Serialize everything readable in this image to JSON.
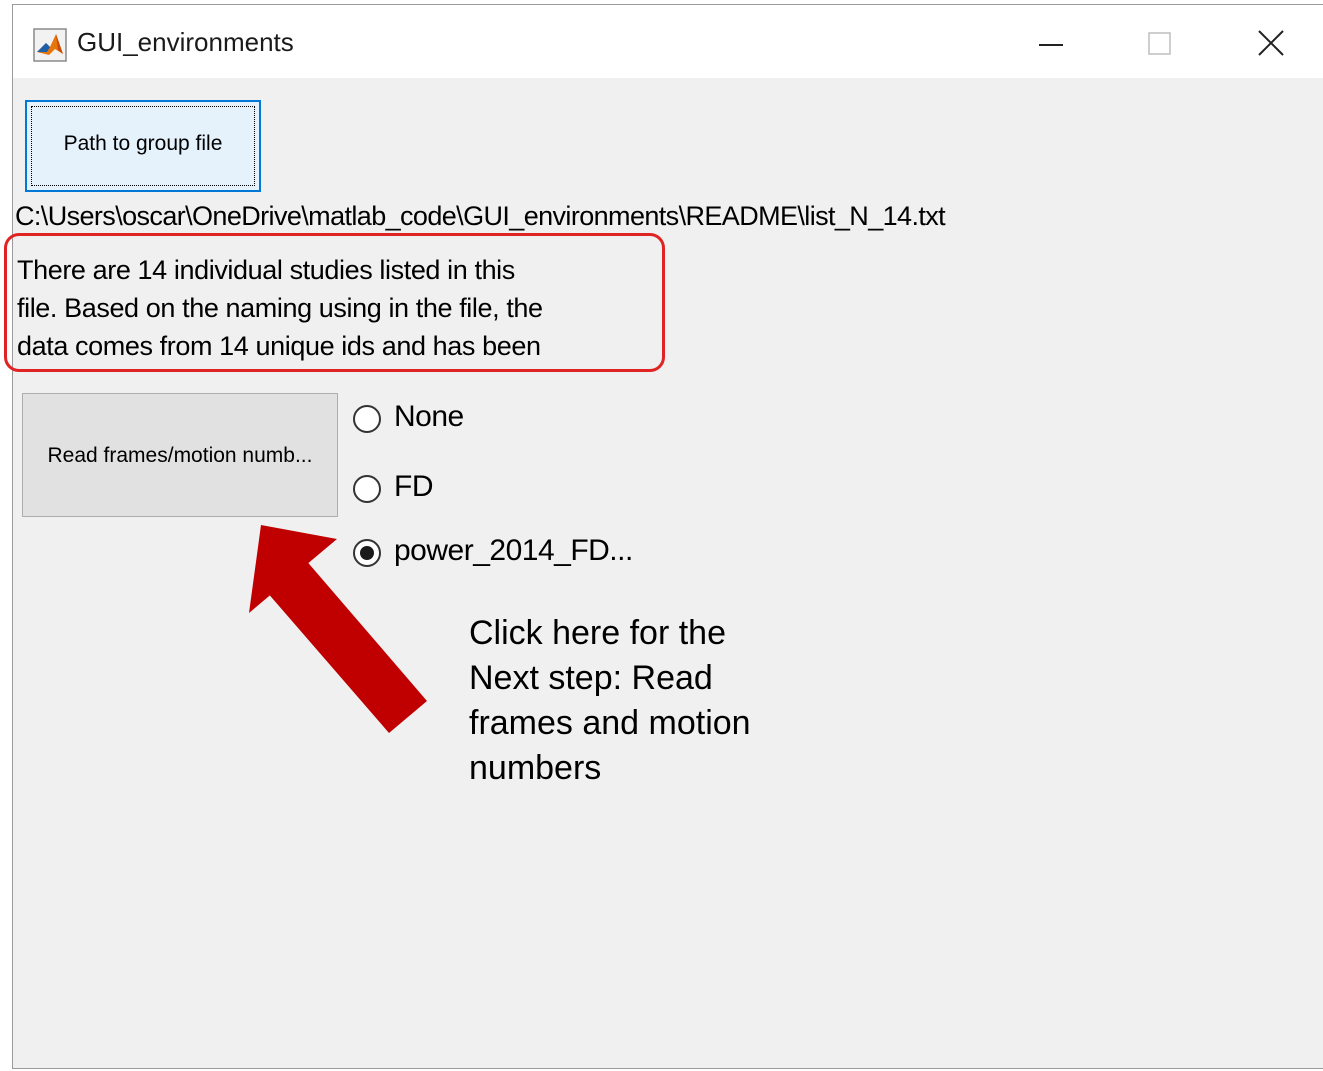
{
  "window": {
    "title": "GUI_environments",
    "icon": "matlab-icon",
    "controls": [
      "minimize-icon",
      "maximize-icon",
      "close-icon"
    ]
  },
  "path_button": {
    "label": "Path to group file"
  },
  "path_value": "C:\\Users\\oscar\\OneDrive\\matlab_code\\GUI_environments\\README\\list_N_14.txt",
  "info_text": "There are 14 individual studies listed in this\nfile. Based on the naming using in the file, the\ndata comes from 14 unique ids and has been",
  "read_button": {
    "label": "Read frames/motion numb..."
  },
  "radio_options": [
    {
      "label": "None",
      "selected": false
    },
    {
      "label": "FD",
      "selected": false
    },
    {
      "label": "power_2014_FD...",
      "selected": true
    }
  ],
  "annotation": {
    "text": "Click here for the\nNext step: Read\nframes and motion\nnumbers",
    "arrow_color": "#c00000",
    "highlight_color": "#e02424"
  },
  "colors": {
    "window_bg": "#f0f0f0",
    "focused_button_bg": "#e5f1fb",
    "focus_border": "#0078d7"
  }
}
